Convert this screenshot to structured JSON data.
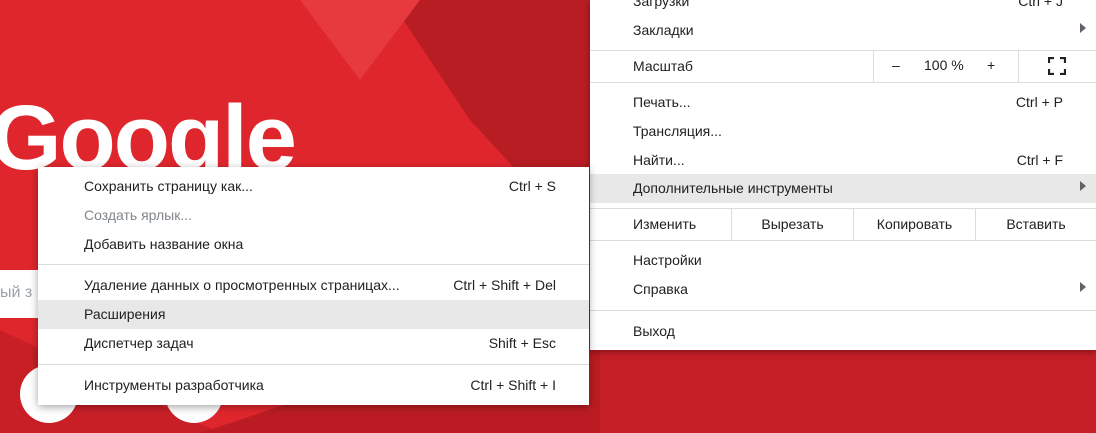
{
  "background": {
    "logo_text": "Google",
    "search_placeholder": "ый з"
  },
  "main_menu": {
    "downloads": {
      "label": "Загрузки",
      "shortcut": "Ctrl + J"
    },
    "bookmarks": {
      "label": "Закладки"
    },
    "zoom": {
      "label": "Масштаб",
      "minus": "–",
      "value": "100 %",
      "plus": "+"
    },
    "print": {
      "label": "Печать...",
      "shortcut": "Ctrl + P"
    },
    "cast": {
      "label": "Трансляция..."
    },
    "find": {
      "label": "Найти...",
      "shortcut": "Ctrl + F"
    },
    "more_tools": {
      "label": "Дополнительные инструменты"
    },
    "edit": {
      "label": "Изменить",
      "cut": "Вырезать",
      "copy": "Копировать",
      "paste": "Вставить"
    },
    "settings": {
      "label": "Настройки"
    },
    "help": {
      "label": "Справка"
    },
    "exit": {
      "label": "Выход"
    }
  },
  "submenu": {
    "save_page": {
      "label": "Сохранить страницу как...",
      "shortcut": "Ctrl + S"
    },
    "create_shortcut": {
      "label": "Создать ярлык..."
    },
    "name_window": {
      "label": "Добавить название окна"
    },
    "clear_data": {
      "label": "Удаление данных о просмотренных страницах...",
      "shortcut": "Ctrl + Shift + Del"
    },
    "extensions": {
      "label": "Расширения"
    },
    "task_manager": {
      "label": "Диспетчер задач",
      "shortcut": "Shift + Esc"
    },
    "dev_tools": {
      "label": "Инструменты разработчика",
      "shortcut": "Ctrl + Shift + I"
    }
  },
  "colors": {
    "background_red": "#d8232a",
    "highlight": "#e8e8e8"
  }
}
